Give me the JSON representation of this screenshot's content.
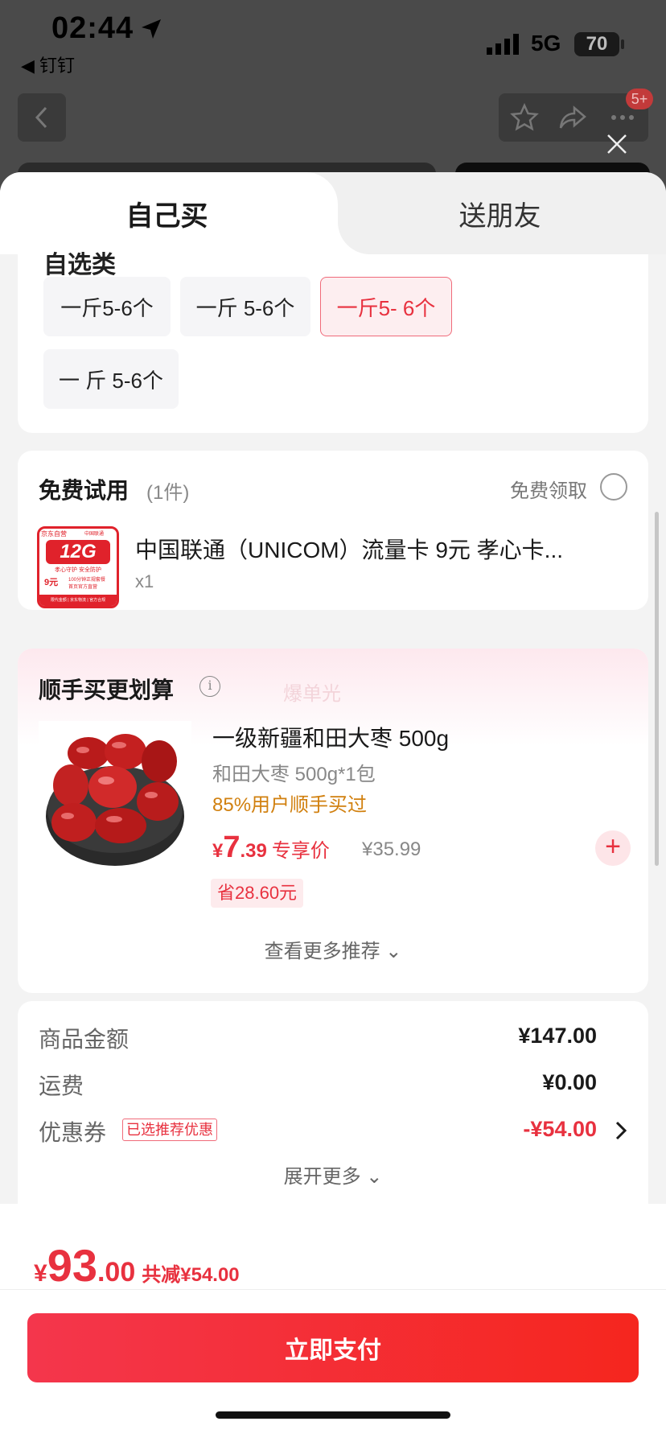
{
  "status_bar": {
    "time": "02:44",
    "back_app": "◀ 钉钉",
    "network": "5G",
    "battery": "70"
  },
  "top_nav": {
    "badge": "5+"
  },
  "tabs": {
    "self_buy": "自己买",
    "gift": "送朋友"
  },
  "specs": {
    "partial_heading": "自选类",
    "options": [
      "一斤5-6个",
      "一斤 5-6个",
      "一斤5- 6个",
      "一 斤 5-6个"
    ],
    "selected_index": 2
  },
  "free_trial": {
    "title": "免费试用",
    "count": "(1件)",
    "claim_label": "免费领取",
    "product_title": "中国联通（UNICOM）流量卡 9元 孝心卡...",
    "quantity": "x1",
    "thumb": {
      "brand": "京东自营",
      "operator": "中国联通",
      "data": "12G",
      "slogan": "孝心守护 安全防护",
      "price": "9元",
      "minutes": "100分钟正规套餐",
      "official": "首页官方直营",
      "footer": "限代金额 | 京东物流 | 官方合规"
    }
  },
  "add_on": {
    "title": "顺手买更划算",
    "info_icon": "i",
    "watermark": "爆单光",
    "product": {
      "name": "一级新疆和田大枣 500g",
      "spec": "和田大枣 500g*1包",
      "social": "85%用户顺手买过",
      "price_symbol": "¥",
      "price_int": "7",
      "price_dec": ".39",
      "price_tag": "专享价",
      "original_price": "¥35.99",
      "save": "省28.60元"
    },
    "add_button": "+",
    "more_label": "查看更多推荐 ⌄"
  },
  "fees": {
    "goods_label": "商品金额",
    "goods_value": "¥147.00",
    "shipping_label": "运费",
    "shipping_value": "¥0.00",
    "coupon_label": "优惠券",
    "coupon_chip": "已选推荐优惠",
    "coupon_value": "-¥54.00",
    "expand_label": "展开更多 ⌄"
  },
  "total": {
    "symbol": "¥",
    "int": "93",
    "dec": ".00",
    "save": "共减¥54.00"
  },
  "pay_button": "立即支付",
  "colors": {
    "accent": "#e8313f",
    "pay_start": "#f4364c",
    "pay_end": "#f5261e",
    "social_proof": "#d1800f"
  }
}
